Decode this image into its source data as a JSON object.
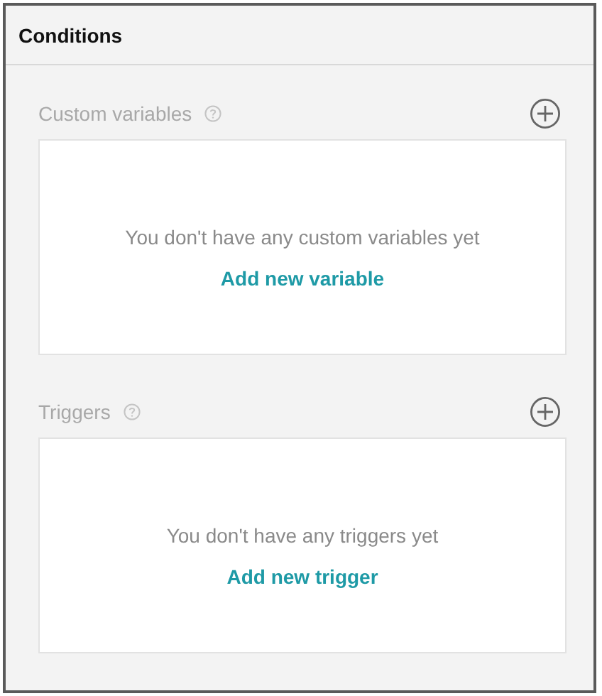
{
  "panel": {
    "title": "Conditions"
  },
  "sections": [
    {
      "title": "Custom variables",
      "empty_message": "You don't have any custom variables yet",
      "action": "Add new variable"
    },
    {
      "title": "Triggers",
      "empty_message": "You don't have any triggers yet",
      "action": "Add new trigger"
    }
  ]
}
